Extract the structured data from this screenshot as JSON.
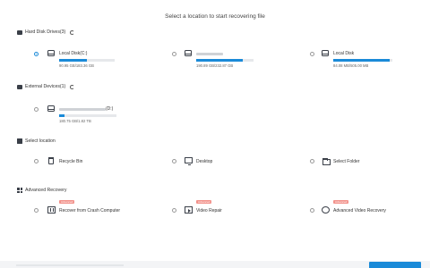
{
  "header": {
    "title": "Select a location to start recovering file"
  },
  "hard_disk": {
    "title": "Hard Disk Drives(3)",
    "drives": [
      {
        "name": "Local Disk(C:)",
        "size": "90.95 GB/183.36 GB",
        "usage_fraction": 0.5,
        "selected": true,
        "name_visible": true
      },
      {
        "name": "",
        "size": "190.89 GB/232.87 GB",
        "usage_fraction": 0.82,
        "selected": false,
        "name_visible": false
      },
      {
        "name": "Local Disk",
        "size": "84.08 MB/505.00 MB",
        "usage_fraction": 0.95,
        "selected": false,
        "name_visible": true
      }
    ]
  },
  "external": {
    "title": "External Devices(1)",
    "drives": [
      {
        "name": "(D:)",
        "size": "180.75 GB/1.82 TB",
        "usage_fraction": 0.1,
        "selected": false
      }
    ]
  },
  "select_location": {
    "title": "Select location",
    "items": [
      {
        "label": "Recycle Bin",
        "icon": "recycle-bin-icon"
      },
      {
        "label": "Desktop",
        "icon": "desktop-icon"
      },
      {
        "label": "Select Folder",
        "icon": "folder-icon"
      }
    ]
  },
  "advanced": {
    "title": "Advanced Recovery",
    "items": [
      {
        "label": "Recover from Crash Computer",
        "badge": "Advanced",
        "icon": "crash-computer-icon"
      },
      {
        "label": "Video Repair",
        "badge": "Advanced",
        "icon": "video-repair-icon"
      },
      {
        "label": "Advanced Video Recovery",
        "badge": "Advanced",
        "icon": "advanced-video-icon"
      }
    ]
  },
  "colors": {
    "accent": "#1a8ad8",
    "badge": "#f2928b",
    "bar_track": "#e6e8eb"
  }
}
